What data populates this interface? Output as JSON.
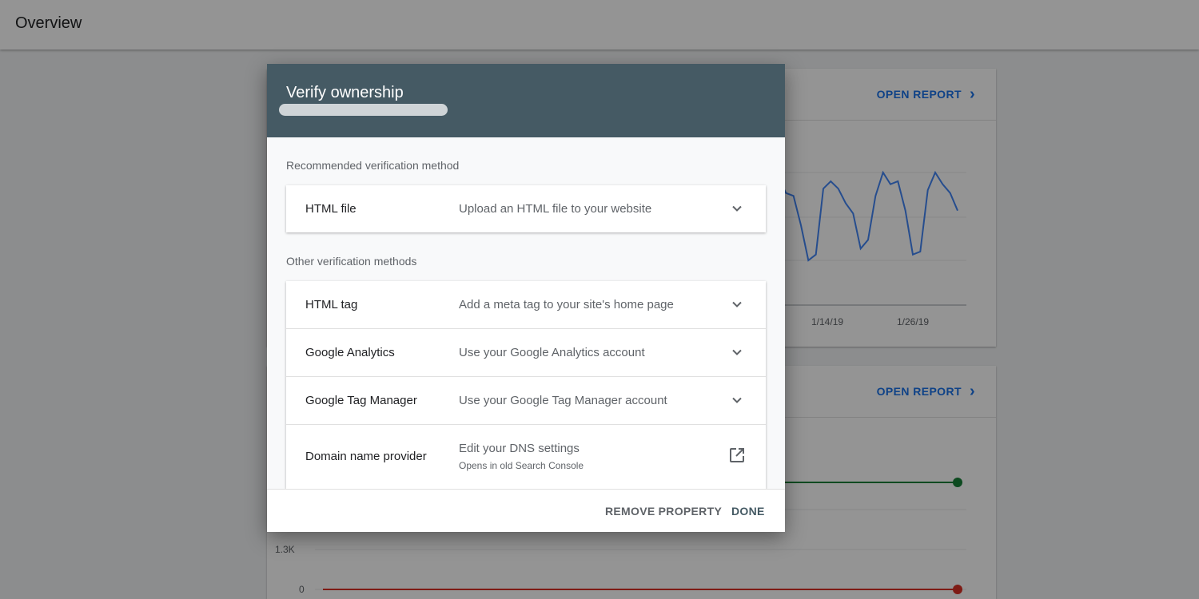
{
  "page": {
    "title": "Overview"
  },
  "cards": [
    {
      "open_report_label": "OPEN REPORT",
      "chart_data": {
        "type": "line",
        "x_tick_labels": [
          "1/14/19",
          "1/26/19"
        ],
        "series": [
          {
            "color": "#4285f4",
            "values": [
              62,
              52,
              50,
              30,
              6,
              10,
              55,
              60,
              55,
              45,
              38,
              14,
              20,
              50,
              66,
              58,
              60,
              40,
              10,
              12,
              54,
              66,
              58,
              52,
              40
            ]
          }
        ]
      }
    },
    {
      "open_report_label": "OPEN REPORT",
      "chart_data": {
        "type": "line",
        "y_tick_labels": [
          "1.3K",
          "0"
        ],
        "series": [
          {
            "color": "#188038",
            "values": [
              1,
              1,
              1,
              1,
              1
            ]
          },
          {
            "color": "#d93025",
            "values": [
              0,
              0,
              0,
              0,
              0
            ]
          }
        ]
      }
    }
  ],
  "dialog": {
    "title": "Verify ownership",
    "recommended_label": "Recommended verification method",
    "other_label": "Other verification methods",
    "recommended": [
      {
        "name": "HTML file",
        "description": "Upload an HTML file to your website",
        "icon": "chevron-down-icon"
      }
    ],
    "others": [
      {
        "name": "HTML tag",
        "description": "Add a meta tag to your site's home page",
        "icon": "chevron-down-icon"
      },
      {
        "name": "Google Analytics",
        "description": "Use your Google Analytics account",
        "icon": "chevron-down-icon"
      },
      {
        "name": "Google Tag Manager",
        "description": "Use your Google Tag Manager account",
        "icon": "chevron-down-icon"
      },
      {
        "name": "Domain name provider",
        "description": "Edit your DNS settings",
        "subtext": "Opens in old Search Console",
        "icon": "open-in-new-icon"
      }
    ],
    "remove_label": "REMOVE PROPERTY",
    "done_label": "DONE"
  }
}
